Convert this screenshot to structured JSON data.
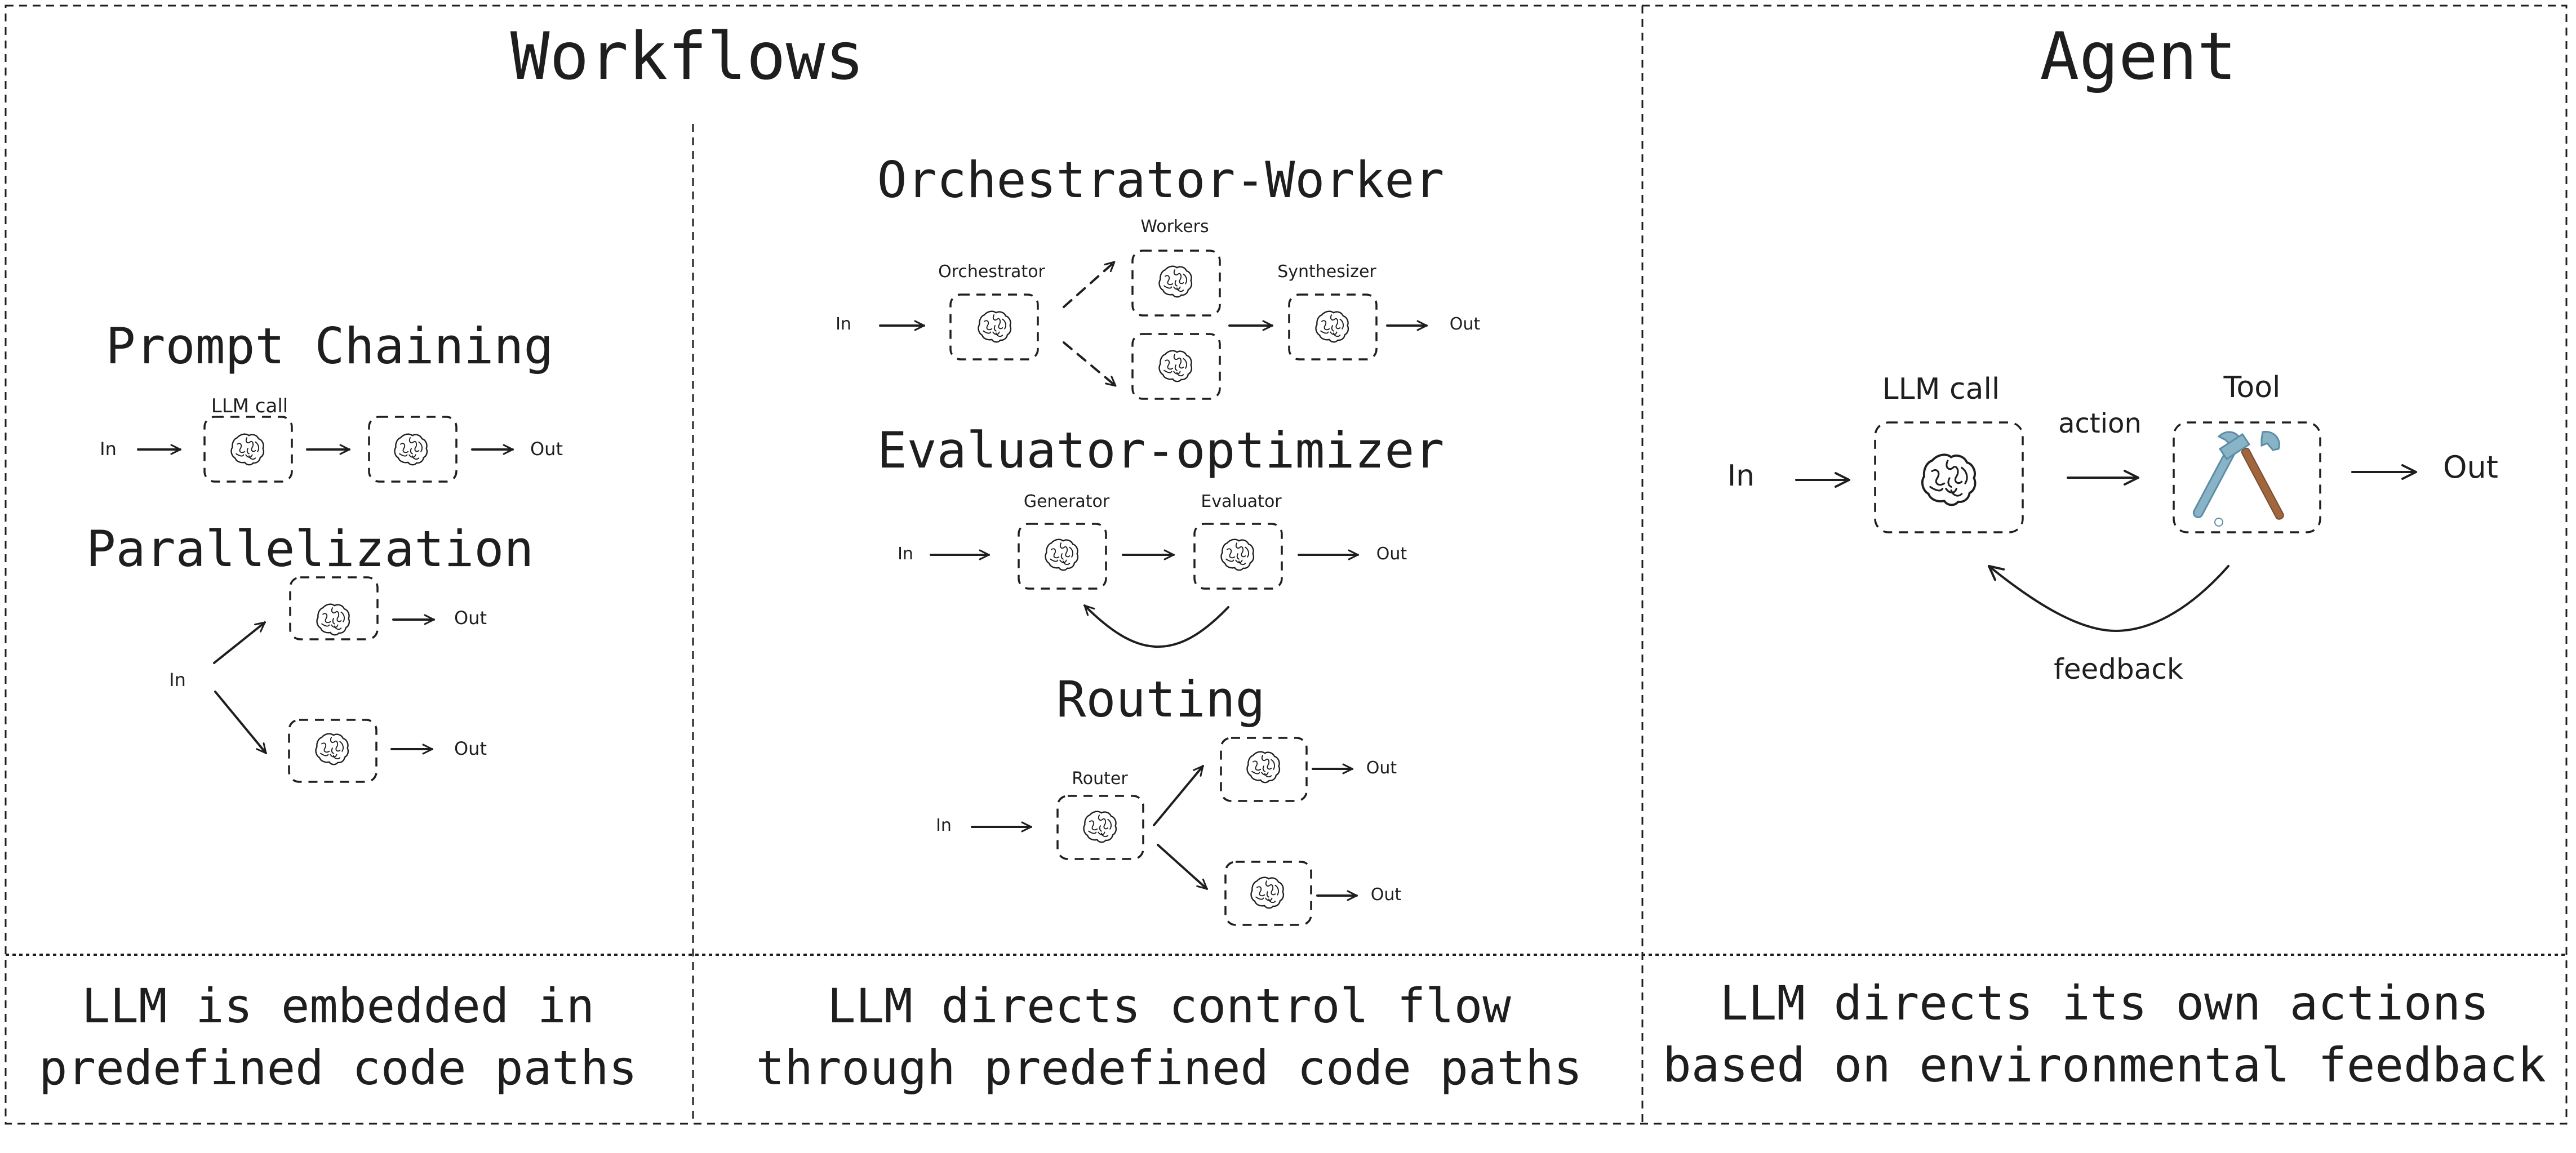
{
  "sections": {
    "workflows": {
      "title": "Workflows",
      "caption_left": [
        "LLM is embedded in",
        "predefined code paths"
      ],
      "caption_middle": [
        "LLM directs control flow",
        "through predefined code paths"
      ]
    },
    "agent": {
      "title": "Agent",
      "caption": [
        "LLM directs its own actions",
        "based on environmental feedback"
      ]
    }
  },
  "patterns": {
    "prompt_chaining": {
      "title": "Prompt Chaining",
      "input": "In",
      "output": "Out",
      "node_label": "LLM call",
      "nodes": [
        {
          "icon": "brain-icon"
        },
        {
          "icon": "brain-icon"
        }
      ]
    },
    "parallelization": {
      "title": "Parallelization",
      "input": "In",
      "outputs": [
        "Out",
        "Out"
      ],
      "nodes": [
        {
          "icon": "brain-icon"
        },
        {
          "icon": "brain-icon"
        }
      ]
    },
    "orchestrator_worker": {
      "title": "Orchestrator-Worker",
      "input": "In",
      "output": "Out",
      "labels": {
        "orchestrator": "Orchestrator",
        "workers": "Workers",
        "synthesizer": "Synthesizer"
      },
      "nodes": [
        {
          "icon": "brain-icon"
        },
        {
          "icon": "brain-icon"
        },
        {
          "icon": "brain-icon"
        },
        {
          "icon": "brain-icon"
        }
      ]
    },
    "evaluator_optimizer": {
      "title": "Evaluator-optimizer",
      "input": "In",
      "output": "Out",
      "labels": {
        "generator": "Generator",
        "evaluator": "Evaluator"
      },
      "nodes": [
        {
          "icon": "brain-icon"
        },
        {
          "icon": "brain-icon"
        }
      ]
    },
    "routing": {
      "title": "Routing",
      "input": "In",
      "outputs": [
        "Out",
        "Out"
      ],
      "labels": {
        "router": "Router"
      },
      "nodes": [
        {
          "icon": "brain-icon"
        },
        {
          "icon": "brain-icon"
        },
        {
          "icon": "brain-icon"
        }
      ]
    },
    "agent_loop": {
      "input": "In",
      "output": "Out",
      "labels": {
        "llm": "LLM call",
        "tool": "Tool",
        "action": "action",
        "feedback": "feedback"
      },
      "nodes": [
        {
          "icon": "brain-icon"
        },
        {
          "icon": "hammer-and-wrench-icon"
        }
      ]
    }
  },
  "colors": {
    "ink": "#1e1e1e",
    "background": "#ffffff",
    "tool_metal": "#89b4c8",
    "tool_metal_dark": "#5d8da4",
    "tool_handle": "#a0673e"
  }
}
